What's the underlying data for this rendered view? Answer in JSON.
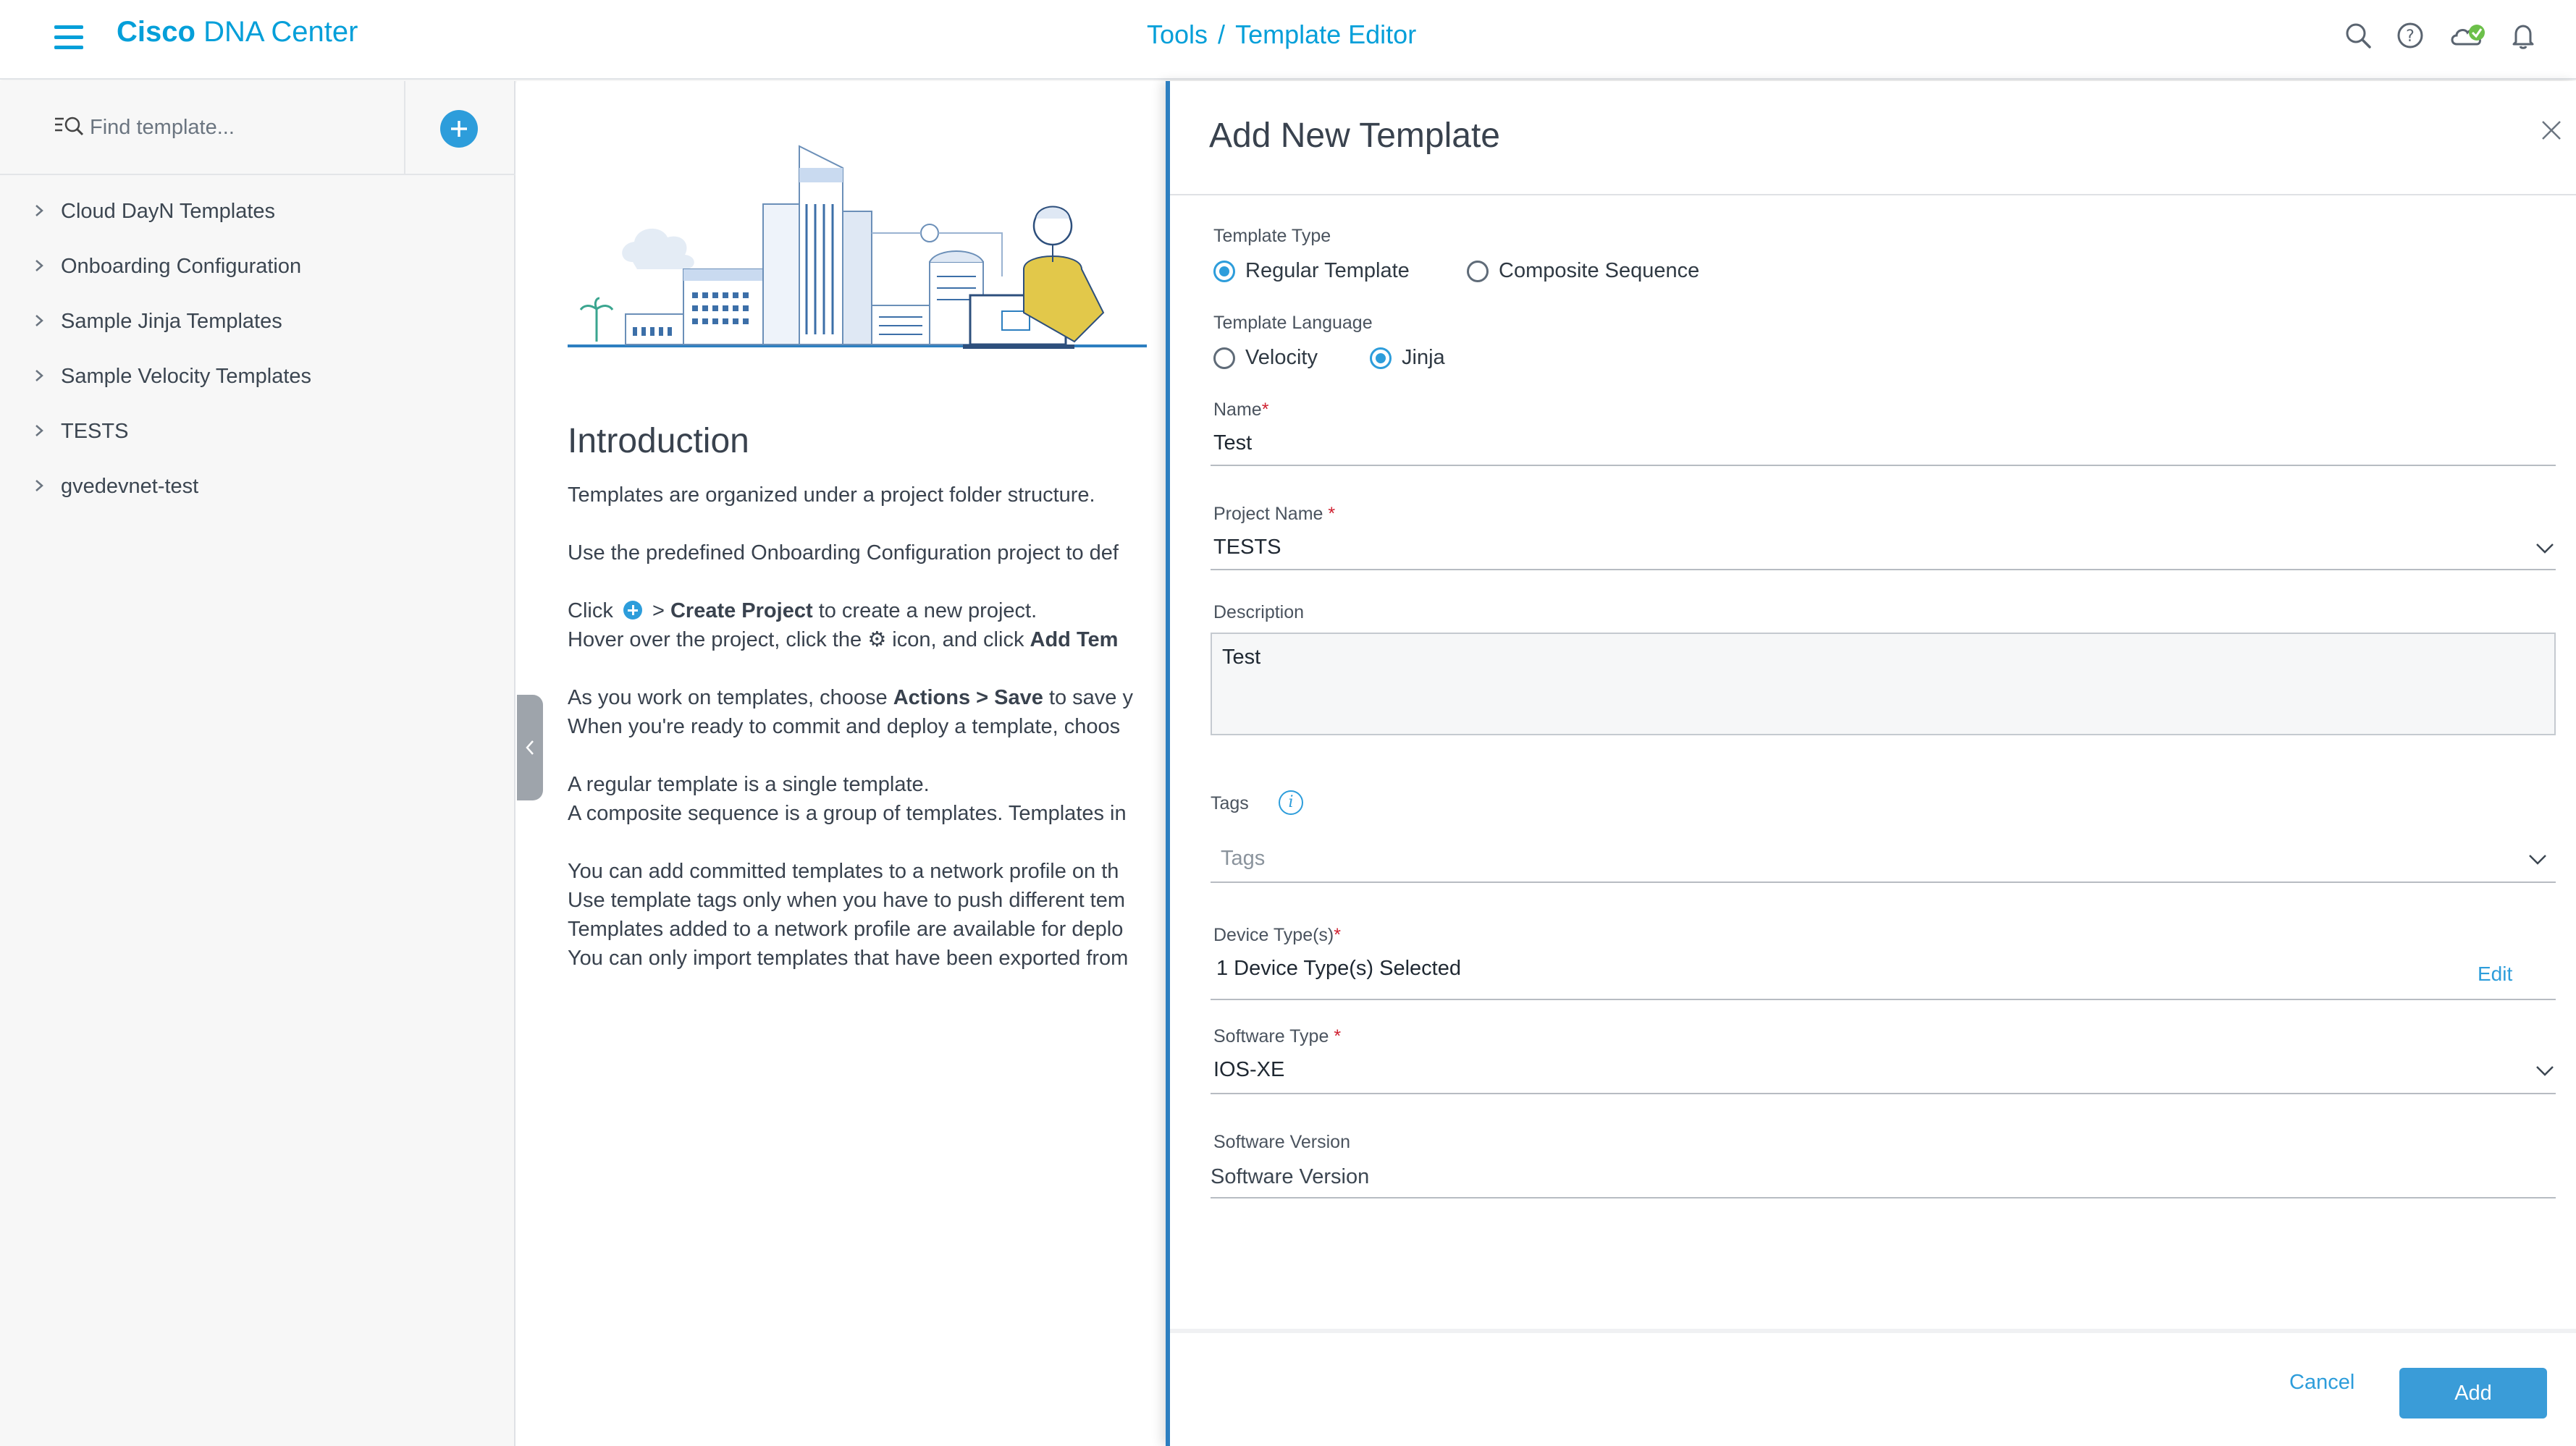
{
  "header": {
    "brand_bold": "Cisco",
    "brand_rest": "DNA Center",
    "breadcrumb": {
      "parent": "Tools",
      "separator": "/",
      "current": "Template Editor"
    },
    "icons": [
      "search-icon",
      "help-icon",
      "cloud-status-icon",
      "bell-icon"
    ],
    "accent_color": "#049fd9"
  },
  "sidebar": {
    "search_placeholder": "Find template...",
    "projects": [
      {
        "label": "Cloud DayN Templates"
      },
      {
        "label": "Onboarding Configuration"
      },
      {
        "label": "Sample Jinja Templates"
      },
      {
        "label": "Sample Velocity Templates"
      },
      {
        "label": "TESTS"
      },
      {
        "label": "gvedevnet-test"
      }
    ]
  },
  "intro": {
    "title": "Introduction",
    "p1": "Templates are organized under a project folder structure.",
    "p2": "Use the predefined Onboarding Configuration project to def",
    "p3_click": "Click",
    "p3_gt": ">",
    "p3_bold": "Create Project",
    "p3_rest": "to create a new project.",
    "p4_a": "Hover over the project, click the",
    "p4_b": "icon, and click",
    "p4_bold": "Add Tem",
    "p5_a": "As you work on templates, choose",
    "p5_bold1": "Actions",
    "p5_gt": ">",
    "p5_bold2": "Save",
    "p5_b": "to save y",
    "p6": "When you're ready to commit and deploy a template, choos",
    "p7": "A regular template is a single template.",
    "p8": "A composite sequence is a group of templates. Templates in",
    "p9": "You can add committed templates to a network profile on th",
    "p10": "Use template tags only when you have to push different tem",
    "p11": "Templates added to a network profile are available for deplo",
    "p12": "You can only import templates that have been exported from"
  },
  "drawer": {
    "title": "Add New Template",
    "template_type": {
      "label": "Template Type",
      "options": [
        "Regular Template",
        "Composite Sequence"
      ],
      "selected": "Regular Template"
    },
    "template_language": {
      "label": "Template Language",
      "options": [
        "Velocity",
        "Jinja"
      ],
      "selected": "Jinja"
    },
    "name": {
      "label": "Name",
      "required_mark": "*",
      "value": "Test"
    },
    "project_name": {
      "label": "Project Name",
      "required_mark": "*",
      "value": "TESTS"
    },
    "description": {
      "label": "Description",
      "value": "Test"
    },
    "tags": {
      "label": "Tags",
      "placeholder": "Tags"
    },
    "device_types": {
      "label": "Device Type(s)",
      "required_mark": "*",
      "value": "1 Device Type(s) Selected",
      "edit_label": "Edit"
    },
    "software_type": {
      "label": "Software Type",
      "required_mark": "*",
      "value": "IOS-XE"
    },
    "software_version": {
      "label": "Software Version",
      "placeholder": "Software Version"
    },
    "cancel_label": "Cancel",
    "add_label": "Add",
    "primary_color": "#3a9cd8"
  }
}
